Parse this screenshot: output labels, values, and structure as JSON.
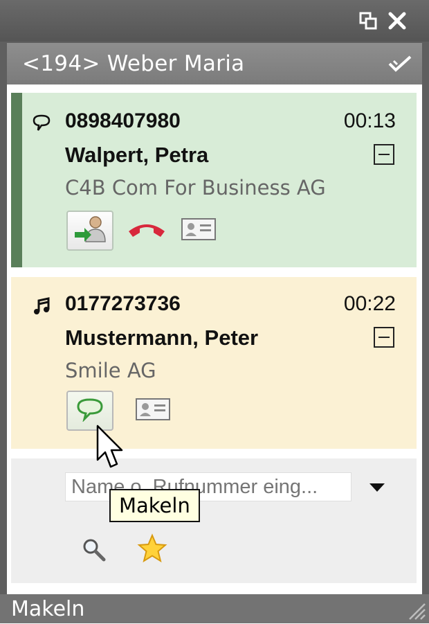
{
  "window": {
    "restore_icon": "restore-window-icon",
    "close_icon": "close-icon"
  },
  "header": {
    "title": "<194> Weber Maria",
    "icon": "check-double-icon"
  },
  "calls": [
    {
      "state_icon": "speech-bubble-icon",
      "number": "0898407980",
      "duration": "00:13",
      "name": "Walpert, Petra",
      "company": "C4B Com For Business AG",
      "actions": [
        "transfer-call-icon",
        "hangup-icon",
        "contact-card-icon"
      ],
      "accent_color": "#5a7f5a",
      "background": "#d8ecd7"
    },
    {
      "state_icon": "music-note-icon",
      "number": "0177273736",
      "duration": "00:22",
      "name": "Mustermann, Peter",
      "company": "Smile AG",
      "actions": [
        "speech-bubble-icon",
        "contact-card-icon"
      ],
      "background": "#fbf1d4"
    }
  ],
  "search": {
    "placeholder": "Name o. Rufnummer eing...",
    "value": "",
    "icons": [
      "magnifier-icon",
      "favorite-star-icon"
    ]
  },
  "tooltip": {
    "text": "Makeln"
  },
  "status": {
    "text": "Makeln"
  }
}
